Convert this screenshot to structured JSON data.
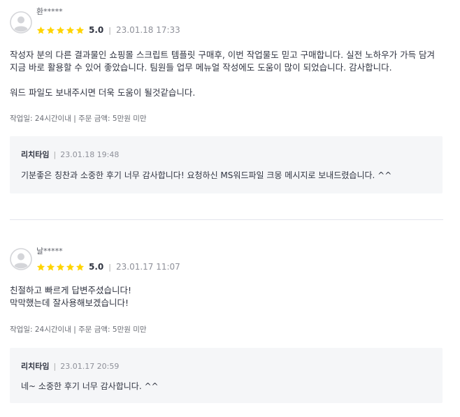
{
  "colors": {
    "star": "#ffd400",
    "text": "#303441",
    "muted": "#8e9099",
    "reply_bg": "#f5f6f8",
    "divider": "#e4e5ed"
  },
  "reviews": [
    {
      "author": "환*****",
      "avatar_icon": "default-avatar-icon",
      "stars": 5,
      "rating": "5.0",
      "separator": "|",
      "date": "23.01.18 17:33",
      "body": "작성자 분의 다른 결과물인 쇼핑몰 스크립트 템플릿 구매후, 이번 작업물도 믿고 구매합니다. 실전 노하우가 가득 담겨\n지금 바로 활용할 수 있어 좋았습니다. 팀원들 업무 메뉴얼 작성에도 도움이 많이 되었습니다. 감사합니다.\n\n워드 파일도 보내주시면 더욱 도움이 될것같습니다.",
      "work_info": "작업일: 24시간이내 | 주문 금액: 5만원 미만",
      "reply": {
        "author": "리치타임",
        "separator": "|",
        "date": "23.01.18 19:48",
        "text": "기분좋은 칭찬과 소중한 후기 너무 감사합니다!  요청하신 MS워드파일 크몽 메시지로 보내드렸습니다. ^^"
      }
    },
    {
      "author": "날*****",
      "avatar_icon": "default-avatar-icon",
      "stars": 5,
      "rating": "5.0",
      "separator": "|",
      "date": "23.01.17 11:07",
      "body": "친절하고 빠르게 답변주셨습니다!\n막막했는데 잘사용해보겠습니다!",
      "work_info": "작업일: 24시간이내 | 주문 금액: 5만원 미만",
      "reply": {
        "author": "리치타임",
        "separator": "|",
        "date": "23.01.17 20:59",
        "text": "네~ 소중한 후기 너무 감사합니다.  ^^"
      }
    }
  ]
}
